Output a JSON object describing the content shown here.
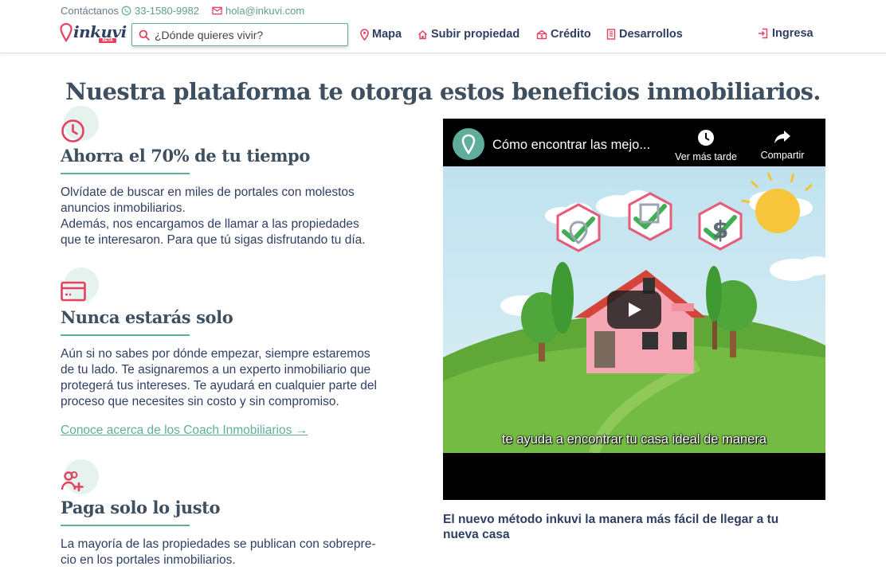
{
  "header": {
    "contact_label": "Contáctanos",
    "phone": "33-1580-9982",
    "email": "hola@inkuvi.com",
    "logo_text": "inkuvi",
    "logo_badge": "BETA",
    "search_placeholder": "¿Dónde quieres vivir?",
    "nav": [
      {
        "label": "Mapa",
        "icon": "map-pin-icon"
      },
      {
        "label": "Subir propiedad",
        "icon": "home-icon"
      },
      {
        "label": "Crédito",
        "icon": "credit-icon"
      },
      {
        "label": "Desarrollos",
        "icon": "building-icon"
      }
    ],
    "login_label": "Ingresa"
  },
  "main": {
    "headline": "Nuestra plataforma te otorga estos beneficios inmobiliarios.",
    "benefits": [
      {
        "icon": "clock-icon",
        "title": "Ahorra el 70% de tu tiempo",
        "lines": [
          "Olvídate de buscar en miles de portales con molestos",
          "anuncios inmobiliarios.",
          "Además, nos encargamos de llamar a las propiedades",
          "que te interesaron. Para que tú sigas disfrutando tu día."
        ]
      },
      {
        "icon": "card-icon",
        "title": "Nunca estarás solo",
        "lines": [
          "Aún si no sabes por dónde empezar, siempre estaremos",
          "de tu lado. Te asignaremos a un experto inmobiliario que",
          "protegerá tus intereses. Te ayudará en cualquier parte del",
          "proceso que necesites sin costo y sin compromiso."
        ],
        "link": "Conoce acerca de los Coach Inmobiliarios →"
      },
      {
        "icon": "users-plus-icon",
        "title": "Paga solo lo justo",
        "lines": [
          "La mayoría de las propiedades se publican con sobrepre-",
          "cio en los portales inmobiliarios."
        ]
      }
    ]
  },
  "video": {
    "title": "Cómo encontrar las mejo...",
    "watch_later": "Ver más tarde",
    "share": "Compartir",
    "subtitle": "te ayuda a encontrar tu casa ideal de manera",
    "caption": "El nuevo método inkuvi la manera más fácil de llegar a tu nueva casa"
  },
  "colors": {
    "primary": "#2f3e63",
    "accent": "#5fae9c",
    "brand_red": "#e4405f",
    "heading": "#3e4f60"
  }
}
